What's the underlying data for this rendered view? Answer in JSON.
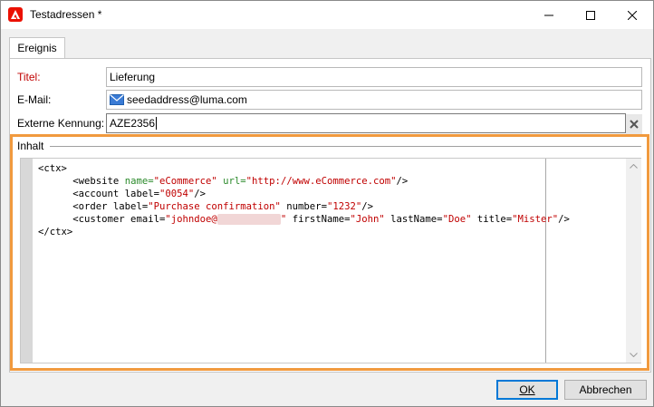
{
  "window": {
    "title": "Testadressen *",
    "controls": [
      "minimize",
      "maximize",
      "close"
    ]
  },
  "tabs": [
    {
      "label": "Ereignis",
      "active": true
    }
  ],
  "form": {
    "title_label": "Titel:",
    "title_value": "Lieferung",
    "email_label": "E-Mail:",
    "email_value": "seedaddress@luma.com",
    "external_id_label": "Externe Kennung:",
    "external_id_value": "AZE2356"
  },
  "content": {
    "label": "Inhalt",
    "lines": [
      "<ctx>",
      "<website name=\"eCommerce\" url=\"http://www.eCommerce.com\"/>",
      "<account label=\"0054\"/>",
      "<order label=\"Purchase confirmation\" number=\"1232\"/>",
      "<customer email=\"johndoe@\" firstName=\"John\" lastName=\"Doe\" title=\"Mister\"/>",
      "</ctx>"
    ],
    "tokens": {
      "ctx_open": "<ctx>",
      "website_tag": "<website",
      "name_attr": "name=",
      "name_val": "\"eCommerce\"",
      "url_attr": "url=",
      "url_val": "\"http://www.eCommerce.com\"",
      "self_close": "/>",
      "account_tag": "<account label=",
      "account_val": "\"0054\"",
      "order_tag": "<order label=",
      "order_label_val": "\"Purchase confirmation\"",
      "number_attr": "number=",
      "number_val": "\"1232\"",
      "customer_tag": "<customer email=",
      "email_val_start": "\"johndoe@",
      "email_val_end": "\"",
      "first_attr": "firstName=",
      "first_val": "\"John\"",
      "last_attr": "lastName=",
      "last_val": "\"Doe\"",
      "title_attr": "title=",
      "title_val": "\"Mister\"",
      "ctx_close": "</ctx>"
    }
  },
  "buttons": {
    "ok_label": "OK",
    "cancel_label": "Abbrechen"
  },
  "colors": {
    "highlight": "#f19a3e",
    "required_label": "#c00000",
    "xml_attr": "#2b8a2b",
    "xml_value": "#c00000",
    "app_icon": "#eb1000",
    "default_button_border": "#0078d7"
  }
}
